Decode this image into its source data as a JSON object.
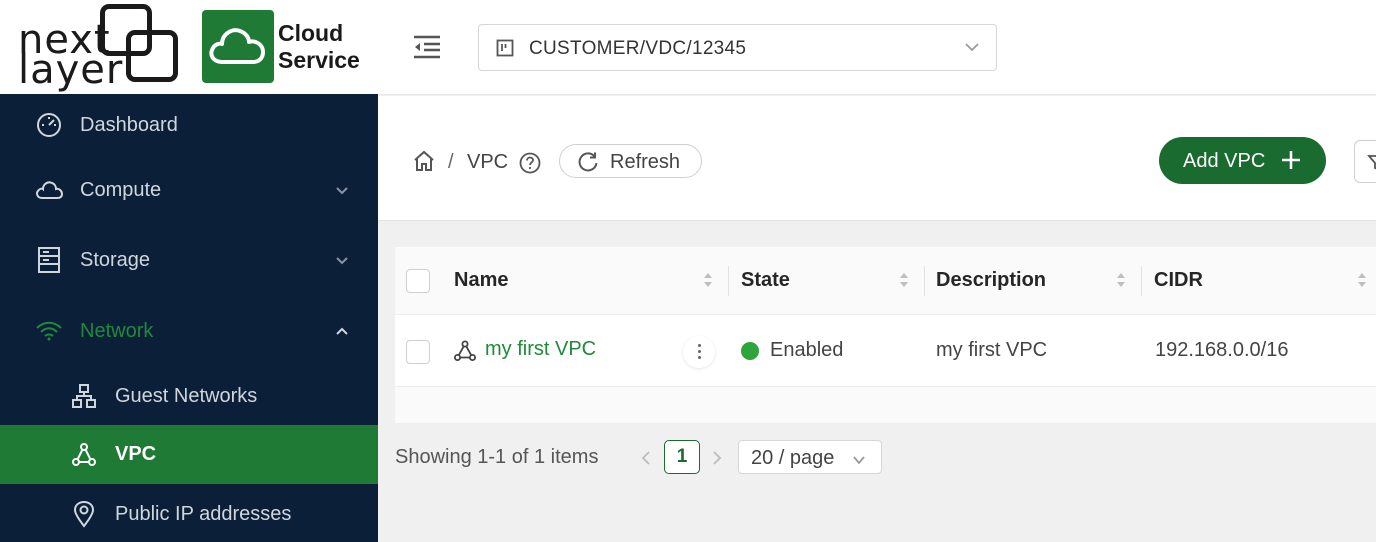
{
  "brand": {
    "logo_word1": "next",
    "logo_word2": "layer",
    "product_line1": "Cloud",
    "product_line2": "Service"
  },
  "sidebar": {
    "items": [
      {
        "label": "Dashboard",
        "icon": "dashboard-icon"
      },
      {
        "label": "Compute",
        "icon": "cloud-icon"
      },
      {
        "label": "Storage",
        "icon": "storage-icon"
      },
      {
        "label": "Network",
        "icon": "wifi-icon"
      },
      {
        "label": "Guest Networks",
        "icon": "network-tree-icon"
      },
      {
        "label": "VPC",
        "icon": "vpc-icon"
      },
      {
        "label": "Public IP addresses",
        "icon": "location-pin-icon"
      }
    ],
    "accent_color": "#1f7a36"
  },
  "header": {
    "project_selector": "CUSTOMER/VDC/12345"
  },
  "breadcrumb": {
    "current": "VPC",
    "separator": "/"
  },
  "toolbar": {
    "refresh_label": "Refresh",
    "add_label": "Add VPC"
  },
  "table": {
    "columns": [
      "Name",
      "State",
      "Description",
      "CIDR"
    ],
    "rows": [
      {
        "name": "my first VPC",
        "state": "Enabled",
        "description": "my first VPC",
        "cidr": "192.168.0.0/16"
      }
    ]
  },
  "pagination": {
    "summary": "Showing 1-1 of 1 items",
    "current_page": "1",
    "page_size": "20 / page"
  }
}
